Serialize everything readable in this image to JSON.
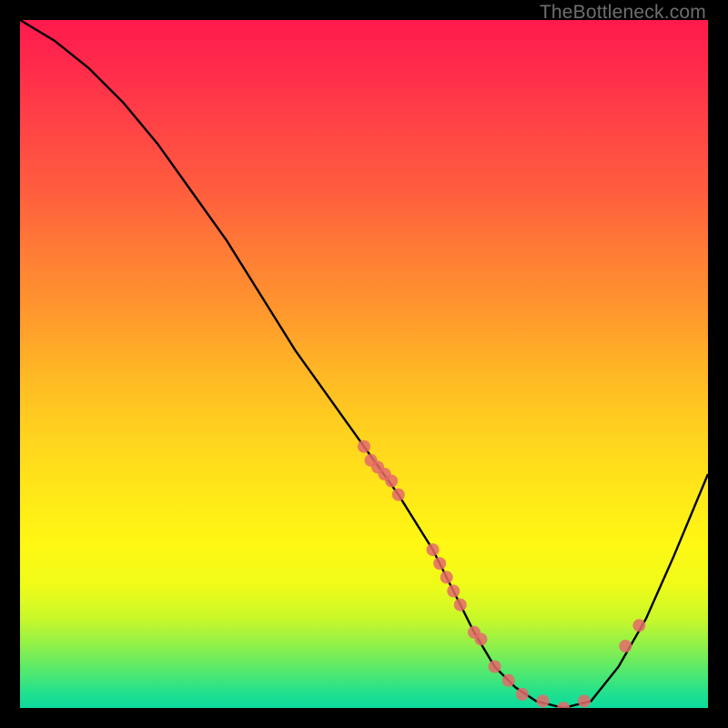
{
  "watermark": "TheBottleneck.com",
  "chart_data": {
    "type": "line",
    "title": "",
    "xlabel": "",
    "ylabel": "",
    "x_range": [
      0,
      100
    ],
    "y_range": [
      0,
      100
    ],
    "grid": false,
    "legend": false,
    "background": "red-yellow-green vertical gradient",
    "series": [
      {
        "name": "bottleneck-curve",
        "color": "#000000",
        "x": [
          0,
          5,
          10,
          15,
          20,
          25,
          30,
          35,
          40,
          45,
          50,
          55,
          60,
          63,
          66,
          69,
          72,
          75,
          79,
          83,
          87,
          91,
          95,
          100
        ],
        "y": [
          100,
          97,
          93,
          88,
          82,
          75,
          68,
          60,
          52,
          45,
          38,
          31,
          23,
          17,
          11,
          6,
          3,
          1,
          0,
          1,
          6,
          13,
          22,
          34
        ]
      }
    ],
    "markers": [
      {
        "name": "data-points",
        "color": "#e46a6a",
        "radius": 7,
        "x": [
          50,
          51,
          52,
          53,
          54,
          55,
          60,
          61,
          62,
          63,
          64,
          66,
          67,
          69,
          71,
          73,
          76,
          79,
          82,
          88,
          90
        ],
        "y": [
          38,
          36,
          35,
          34,
          33,
          31,
          23,
          21,
          19,
          17,
          15,
          11,
          10,
          6,
          4,
          2,
          1,
          0,
          1,
          9,
          12
        ]
      }
    ]
  }
}
